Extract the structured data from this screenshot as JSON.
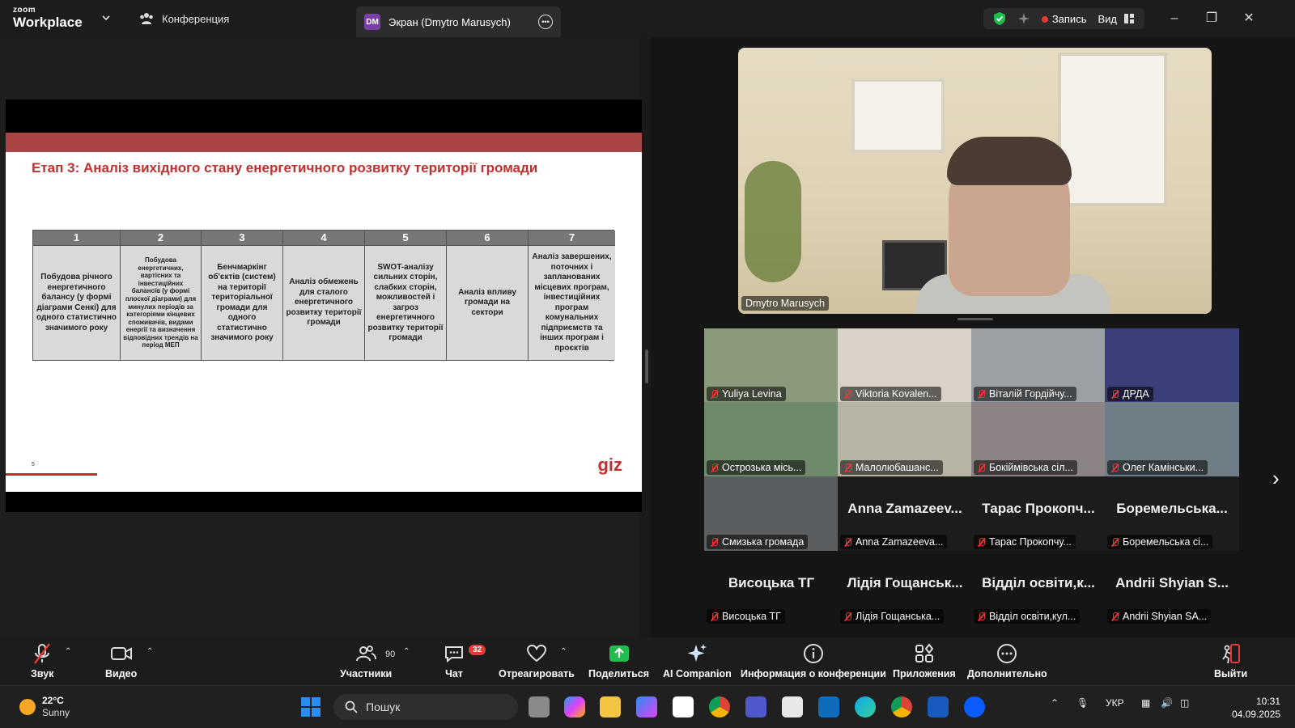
{
  "titlebar": {
    "brand_small": "zoom",
    "brand_big": "Workplace",
    "tab_conference": "Конференция",
    "tab_screen": "Экран (Dmytro Marusych)",
    "screen_badge": "DM",
    "record_label": "Запись",
    "view_label": "Вид"
  },
  "slide": {
    "title": "Етап 3: Аналіз вихідного стану енергетичного розвитку території громади",
    "columns": [
      {
        "num": "1",
        "text": "Побудова річного енергетичного балансу (у формі діаграми Сенкі) для одного статистично значимого року"
      },
      {
        "num": "2",
        "text": "Побудова енергетичних, вартісних та інвестиційних балансів (у формі плоскої діаграми) для минулих періодів за категоріями кінцевих споживачів, видами енергії та визначення відповідних трендів на період МЕП"
      },
      {
        "num": "3",
        "text": "Бенчмаркінг об'єктів (систем) на території територіальної громади для одного статистично значимого року"
      },
      {
        "num": "4",
        "text": "Аналіз обмежень для сталого енергетичного розвитку території громади"
      },
      {
        "num": "5",
        "text": "SWOT-аналізу сильних сторін, слабких сторін, можливостей і загроз енергетичного розвитку території громади"
      },
      {
        "num": "6",
        "text": "Аналіз впливу громади на сектори"
      },
      {
        "num": "7",
        "text": "Аналіз завершених, поточних і запланованих місцевих програм, інвестиційних програм комунальних підприємств та інших програм і проєктів"
      }
    ],
    "page_number": "5",
    "logo": "giz"
  },
  "speaker": {
    "name": "Dmytro Marusych"
  },
  "participants": [
    {
      "tag": "Yuliya Levina",
      "big": "",
      "bg": "#8a9a7a"
    },
    {
      "tag": "Viktoria Kovalen...",
      "big": "",
      "bg": "#d8d2c8"
    },
    {
      "tag": "Віталій Гордійчу...",
      "big": "",
      "bg": "#9aa0a4"
    },
    {
      "tag": "ДРДА",
      "big": "",
      "bg": "#3a3f7a"
    },
    {
      "tag": "Острозька місь...",
      "big": "",
      "bg": "#6f8a6a"
    },
    {
      "tag": "Малолюбашанс...",
      "big": "",
      "bg": "#b8b4a4"
    },
    {
      "tag": "Бокіймівська сіл...",
      "big": "",
      "bg": "#8c8484"
    },
    {
      "tag": "Олег Камінськи...",
      "big": "",
      "bg": "#6f7e86"
    },
    {
      "tag": "Смизька громада",
      "big": "",
      "bg": "#5a5e60"
    },
    {
      "tag": "Anna Zamazeeva...",
      "big": "Anna Zamazeev...",
      "bg": "#1c1c1c"
    },
    {
      "tag": "Тарас Прокопчу...",
      "big": "Тарас Прокопч...",
      "bg": "#1c1c1c"
    },
    {
      "tag": "Боремельська сі...",
      "big": "Боремельська...",
      "bg": "#1c1c1c"
    },
    {
      "tag": "Висоцька ТГ",
      "big": "Висоцька ТГ",
      "bg": "#151515"
    },
    {
      "tag": "Лідія Гощанська...",
      "big": "Лідія Гощанськ...",
      "bg": "#151515"
    },
    {
      "tag": "Відділ освіти,кул...",
      "big": "Відділ освіти,к...",
      "bg": "#151515"
    },
    {
      "tag": "Andrii Shyian SA...",
      "big": "Andrii Shyian S...",
      "bg": "#151515"
    }
  ],
  "toolbar": {
    "audio": "Звук",
    "video": "Видео",
    "participants": "Участники",
    "participants_count": "90",
    "chat": "Чат",
    "chat_badge": "32",
    "react": "Отреагировать",
    "share": "Поделиться",
    "ai": "AI Companion",
    "info": "Информация о конференции",
    "apps": "Приложения",
    "more": "Дополнительно",
    "leave": "Выйти"
  },
  "taskbar": {
    "temp": "22°C",
    "weather": "Sunny",
    "search": "Пошук",
    "lang": "УКР",
    "time": "10:31",
    "date": "04.09.2025"
  },
  "colors": {
    "slide_accent": "#c0302f",
    "slide_bar": "#a84646",
    "share_green": "#1fbd4f",
    "record_red": "#e53935"
  }
}
